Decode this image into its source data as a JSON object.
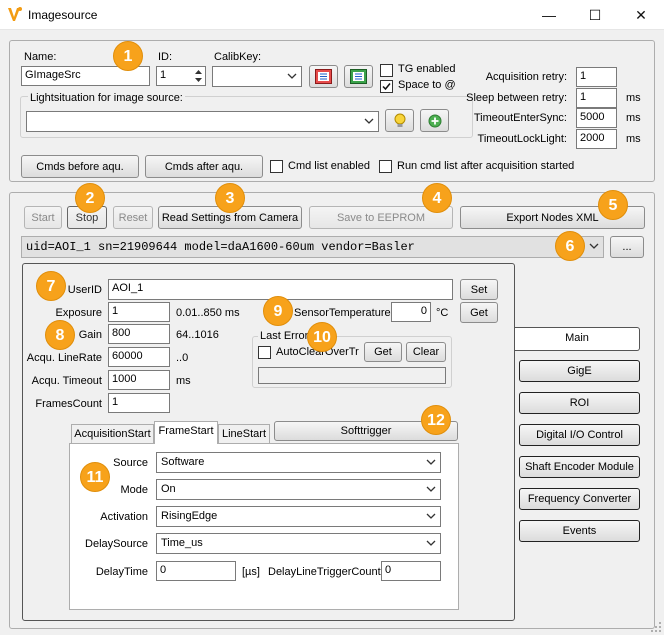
{
  "window": {
    "title": "Imagesource",
    "minimize_glyph": "—",
    "maximize_glyph": "☐",
    "close_glyph": "✕"
  },
  "top_group": {
    "name_label": "Name:",
    "name_value": "GImageSrc",
    "id_label": "ID:",
    "id_value": "1",
    "calibkey_label": "CalibKey:",
    "calibkey_value": "",
    "tg_enabled_label": "TG enabled",
    "tg_enabled_checked": false,
    "space_label": "Space to @",
    "space_checked": true,
    "lightsituation_label": "Lightsituation for image source:",
    "lightsituation_value": "",
    "cmds_before_label": "Cmds before aqu.",
    "cmds_after_label": "Cmds after aqu.",
    "cmd_list_enabled_label": "Cmd list enabled",
    "run_cmd_list_label": "Run cmd list after acquisition started",
    "acq_retry_label": "Acquisition retry:",
    "acq_retry_value": "1",
    "sleep_label": "Sleep between retry:",
    "sleep_value": "1",
    "sleep_unit": "ms",
    "timeout_enter_label": "TimeoutEnterSync:",
    "timeout_enter_value": "5000",
    "timeout_enter_unit": "ms",
    "timeout_lock_label": "TimeoutLockLight:",
    "timeout_lock_value": "2000",
    "timeout_lock_unit": "ms"
  },
  "camera_group": {
    "start_label": "Start",
    "stop_label": "Stop",
    "reset_label": "Reset",
    "read_settings_label": "Read Settings from Camera",
    "save_eeprom_label": "Save to EEPROM",
    "export_xml_label": "Export Nodes XML",
    "device_value": "uid=AOI_1 sn=21909644 model=daA1600-60um vendor=Basler",
    "browse_label": "..."
  },
  "main_panel": {
    "userid_label": "UserID",
    "userid_value": "AOI_1",
    "set_label": "Set",
    "get_label": "Get",
    "exposure_label": "Exposure",
    "exposure_value": "1",
    "exposure_range": "0.01..850 ms",
    "sensor_temp_label": "SensorTemperature",
    "sensor_temp_value": "0",
    "sensor_temp_unit": "°C",
    "gain_label": "Gain",
    "gain_value": "800",
    "gain_range": "64..1016",
    "last_error_label": "Last Error",
    "auto_clear_label": "AutoClearOverTr",
    "error_get_label": "Get",
    "error_clear_label": "Clear",
    "error_value": "",
    "linerate_label": "Acqu. LineRate",
    "linerate_value": "60000",
    "linerate_range": "..0",
    "acq_timeout_label": "Acqu. Timeout",
    "acq_timeout_value": "1000",
    "acq_timeout_unit": "ms",
    "frames_label": "FramesCount",
    "frames_value": "1"
  },
  "trigger": {
    "tabs": [
      "AcquisitionStart",
      "FrameStart",
      "LineStart"
    ],
    "softtrigger_label": "Softtrigger",
    "source_label": "Source",
    "source_value": "Software",
    "mode_label": "Mode",
    "mode_value": "On",
    "activation_label": "Activation",
    "activation_value": "RisingEdge",
    "delaysource_label": "DelaySource",
    "delaysource_value": "Time_us",
    "delaytime_label": "DelayTime",
    "delaytime_value": "0",
    "delaytime_unit": "[µs]",
    "delayline_label": "DelayLineTriggerCount",
    "delayline_value": "0"
  },
  "sidebar": {
    "items": [
      "Main",
      "GigE",
      "ROI",
      "Digital I/O Control",
      "Shaft Encoder Module",
      "Frequency Converter",
      "Events"
    ]
  },
  "badges": [
    "1",
    "2",
    "3",
    "4",
    "5",
    "6",
    "7",
    "8",
    "9",
    "10",
    "11",
    "12"
  ],
  "colors": {
    "badge": "#f7a21b",
    "window_bg": "#f0f0f0",
    "accent_red": "#cc2a2a",
    "accent_blue": "#1e5fc9"
  }
}
